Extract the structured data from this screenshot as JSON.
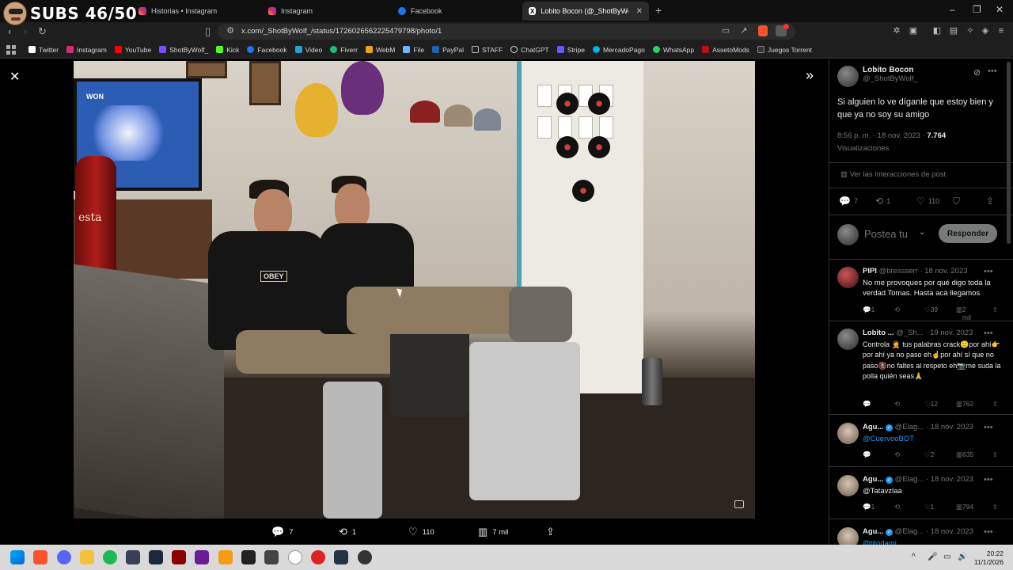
{
  "overlay": {
    "subs": "SUBS 46/50"
  },
  "tabs": [
    {
      "label": "Historias • Instagram",
      "icon": "instagram-icon"
    },
    {
      "label": "Instagram",
      "icon": "instagram-icon"
    },
    {
      "label": "Facebook",
      "icon": "facebook-icon"
    },
    {
      "label": "Lobito Bocon (@_ShotByWolf_) / ",
      "icon": "x-icon",
      "active": true
    }
  ],
  "addressbar": {
    "url": "x.com/_ShotByWolf_/status/1726026562225479798/photo/1"
  },
  "bookmarks": [
    "Twitter",
    "Instagram",
    "YouTube",
    "ShotByWolf_",
    "Kick",
    "Facebook",
    "Video",
    "Fiverr",
    "WebM",
    "File",
    "PayPal",
    "STAFF",
    "ChatGPT",
    "Stripe",
    "MercadoPago",
    "WhatsApp",
    "AssetoMods",
    "Juegos Torrent"
  ],
  "photo": {
    "tv_text": "WON",
    "bottle_text": "esta",
    "hoodie_text": "OBEY"
  },
  "photo_actions": {
    "replies": "7",
    "reposts": "1",
    "likes": "110",
    "views": "7 mil"
  },
  "post": {
    "name": "Lobito Bocon",
    "handle": "@_ShotByWolf_",
    "text": "Si alguien lo ve díganle que estoy bien y que ya no soy su amigo",
    "time": "8:56 p. m. · 18 nov. 2023 · ",
    "views_count": "7.764",
    "views_label": "Visualizaciones",
    "interactions": "Ver las interacciones de post",
    "replies": "7",
    "reposts": "1",
    "likes": "110"
  },
  "reply_box": {
    "placeholder": "Postea tu",
    "button": "Responder"
  },
  "replies": [
    {
      "name": "PIPI",
      "handle": "@bressserr · 18 nov. 2023",
      "text": "No me provoques por qué digo toda la verdad Tomas. Hasta acá llegamos",
      "replies": "1",
      "likes": "39",
      "views": "2 mil"
    },
    {
      "name": "Lobito ...",
      "handle": "@_Sh... · 19 nov. 2023",
      "text": "Controla 🤦 tus palabras crack🙂por ahí👉por ahí ya no paso eh☝️por ahí sí que no paso🚷no faltes al respeto eh📷me suda la polla quién seas🙏",
      "replies": "",
      "likes": "12",
      "views": "762"
    },
    {
      "name": "Agu...",
      "handle": "@Elag... · 18 nov. 2023",
      "text": "@CuervooBOT",
      "replies": "",
      "likes": "2",
      "views": "635"
    },
    {
      "name": "Agu...",
      "handle": "@Elag... · 18 nov. 2023",
      "text": "@Tatavzlaa",
      "replies": "1",
      "likes": "1",
      "views": "794"
    },
    {
      "name": "Agu...",
      "handle": "@Elag... · 18 nov. 2023",
      "text": "@titodami",
      "replies": "",
      "likes": "",
      "views": ""
    }
  ],
  "taskbar": {
    "time": "20:22",
    "date": "11/1/2026"
  }
}
